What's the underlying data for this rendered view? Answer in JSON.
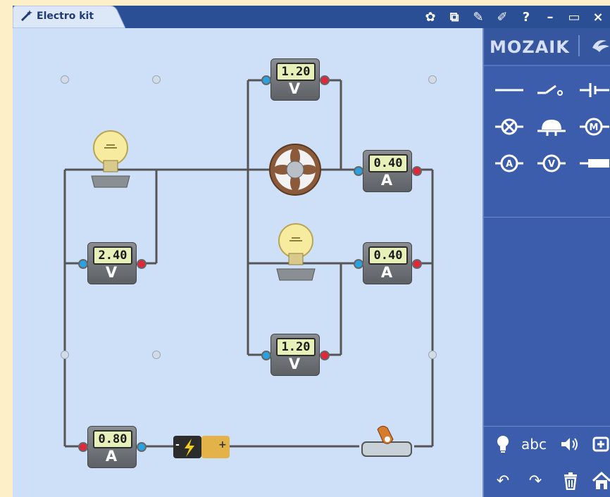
{
  "window": {
    "title": "Electro kit",
    "toolbar_icons": [
      "molecule-icon",
      "3d-view-icon",
      "pencil-icon",
      "pin-icon",
      "help-icon",
      "minimize-icon",
      "maximize-icon",
      "close-icon"
    ],
    "toolbar_glyphs": [
      "✿",
      "⧉",
      "✎",
      "✐",
      "?",
      "–",
      "▭",
      "×"
    ]
  },
  "brand": {
    "logo": "MOZAIK"
  },
  "palette": {
    "components": [
      "wire",
      "switch",
      "capacitor",
      "lamp",
      "bell",
      "motor",
      "ammeter",
      "voltmeter",
      "resistor"
    ],
    "symbols": {
      "ammeter": "A",
      "voltmeter": "V",
      "motor": "M"
    }
  },
  "bottom_tools": {
    "row1": [
      "lightbulb-icon",
      "text-tool",
      "speaker-icon",
      "plus-icon"
    ],
    "row1_labels": [
      "💡",
      "abc",
      "🔊",
      "⊕"
    ],
    "row2": [
      "undo-icon",
      "redo-icon",
      "trash-icon",
      "home-icon"
    ],
    "row2_labels": [
      "↶",
      "↷",
      "🗑",
      "⌂"
    ]
  },
  "meters": {
    "v_top": {
      "value": "1.20",
      "unit": "V"
    },
    "a_fan": {
      "value": "0.40",
      "unit": "A"
    },
    "v_left": {
      "value": "2.40",
      "unit": "V"
    },
    "a_mid": {
      "value": "0.40",
      "unit": "A"
    },
    "v_bottom": {
      "value": "1.20",
      "unit": "V"
    },
    "a_bottom": {
      "value": "0.80",
      "unit": "A"
    }
  },
  "battery": {
    "minus": "-",
    "plus": "+"
  },
  "colors": {
    "title_bar": "#2a4f95",
    "workspace": "#cde0f7",
    "panel": "#3b5dac",
    "frame": "#fdf0c8"
  }
}
